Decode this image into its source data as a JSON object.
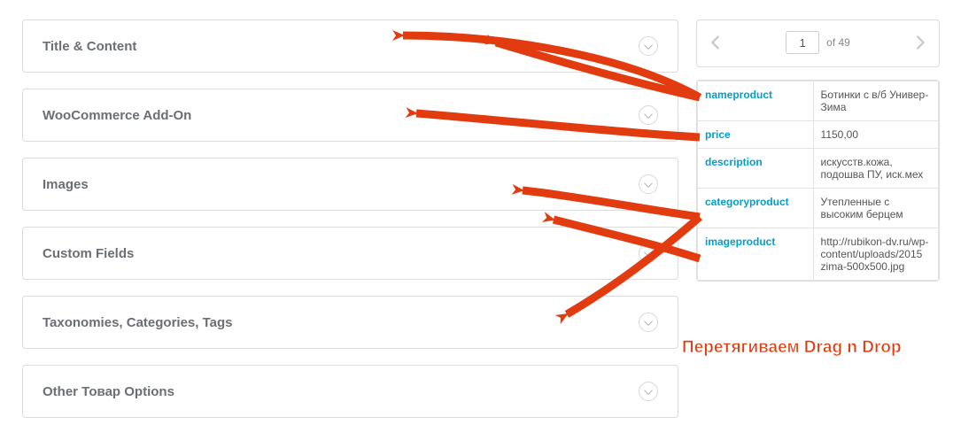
{
  "panels": [
    "Title & Content",
    "WooCommerce Add-On",
    "Images",
    "Custom Fields",
    "Taxonomies, Categories, Tags",
    "Other Товар Options"
  ],
  "pager": {
    "current": "1",
    "of_label": "of 49"
  },
  "preview": [
    {
      "key": "nameproduct",
      "val": "Ботинки с в/б Универ-Зима"
    },
    {
      "key": "price",
      "val": "1150,00"
    },
    {
      "key": "description",
      "val": "искусств.кожа, подошва ПУ, иск.мех"
    },
    {
      "key": "categoryproduct",
      "val": "Утепленные с высоким берцем"
    },
    {
      "key": "imageproduct",
      "val": "http://rubikon-dv.ru/wp-content/uploads/2015 zima-500x500.jpg"
    }
  ],
  "annotation": "Перетягиваем Drag n Drop"
}
